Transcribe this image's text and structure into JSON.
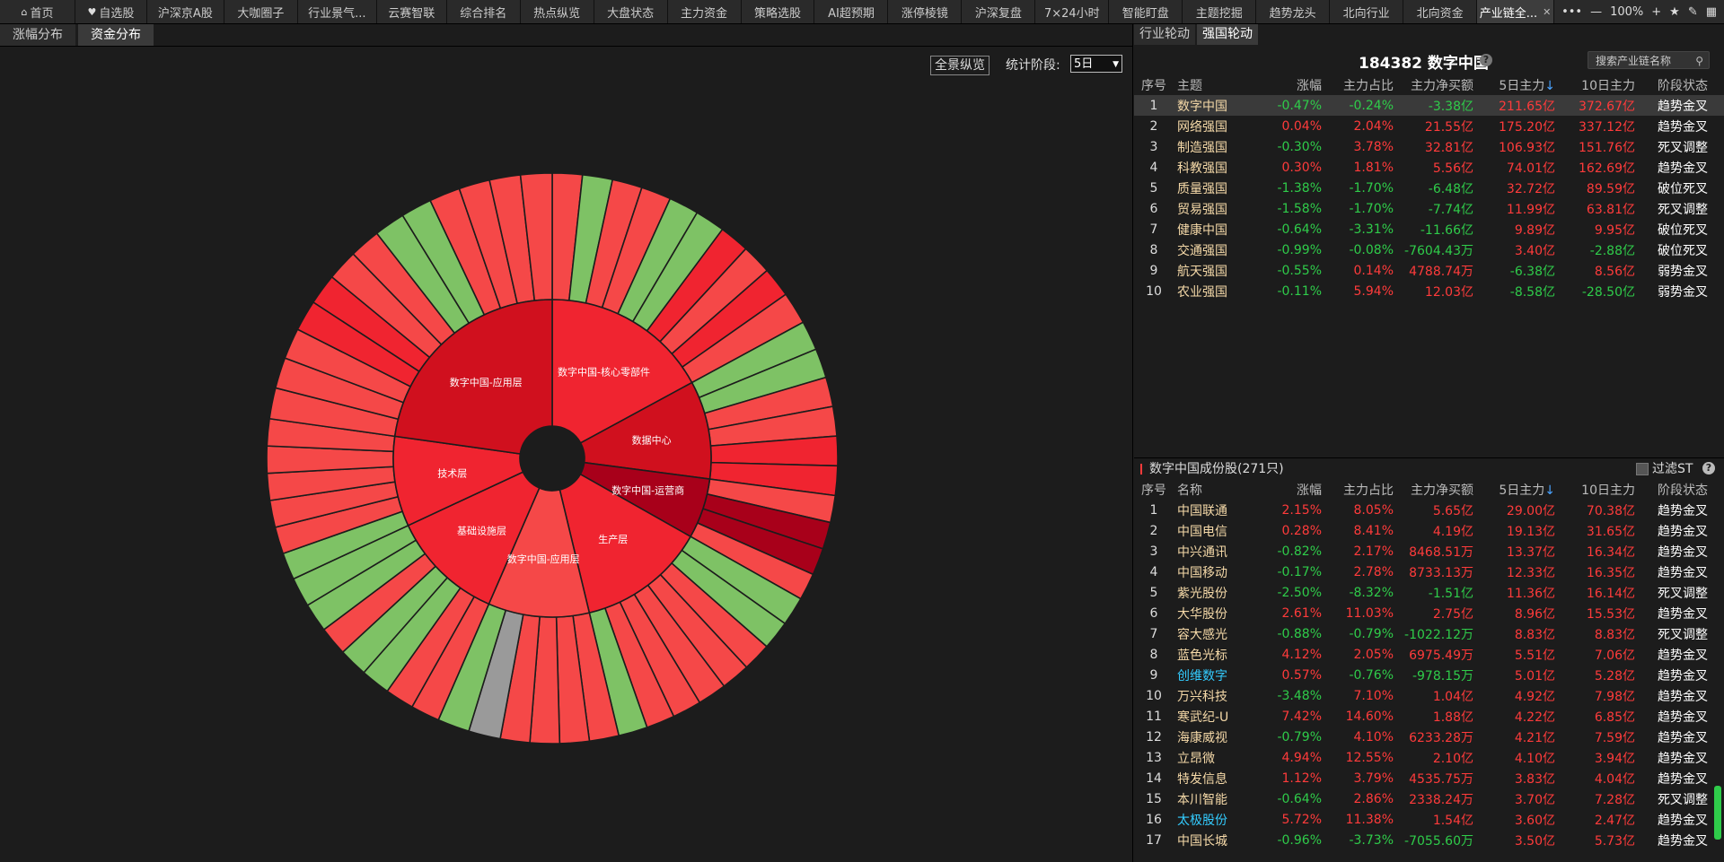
{
  "topbar": {
    "tabs": [
      {
        "label": "首页",
        "icon": "home-icon",
        "active": false
      },
      {
        "label": "自选股",
        "icon": "heart-icon",
        "active": false
      },
      {
        "label": "沪深京A股",
        "active": false
      },
      {
        "label": "大咖圈子",
        "active": false
      },
      {
        "label": "行业景气...",
        "active": false
      },
      {
        "label": "云赛智联",
        "active": false
      },
      {
        "label": "综合排名",
        "active": false
      },
      {
        "label": "热点纵览",
        "active": false
      },
      {
        "label": "大盘状态",
        "active": false
      },
      {
        "label": "主力资金",
        "active": false
      },
      {
        "label": "策略选股",
        "active": false
      },
      {
        "label": "AI超预期",
        "active": false
      },
      {
        "label": "涨停棱镜",
        "active": false
      },
      {
        "label": "沪深复盘",
        "active": false
      },
      {
        "label": "7×24小时",
        "active": false
      },
      {
        "label": "智能盯盘",
        "active": false
      },
      {
        "label": "主题挖掘",
        "active": false
      },
      {
        "label": "趋势龙头",
        "active": false
      },
      {
        "label": "北向行业",
        "active": false
      },
      {
        "label": "北向资金",
        "active": false
      },
      {
        "label": "产业链全...",
        "active": true,
        "closable": true
      }
    ],
    "zoom": "100%",
    "controls": {
      "more": "•••",
      "zoom_out": "—",
      "zoom_in": "+",
      "star": "★",
      "edit": "✎",
      "grid": "▦"
    }
  },
  "left": {
    "subtabs": [
      {
        "label": "涨幅分布",
        "active": false
      },
      {
        "label": "资金分布",
        "active": true
      }
    ],
    "overview_button": "全景纵览",
    "period_label": "统计阶段:",
    "period_value": "5日",
    "sunburst": {
      "colors": {
        "bright_red": "#f54848",
        "red": "#f02430",
        "dark_red": "#d0101e",
        "deep_red": "#a8001a",
        "green": "#7ec265",
        "gray": "#9a9a9a",
        "border": "#1c1c1c",
        "hole": "#1c1c1c"
      },
      "inner_segments": [
        {
          "label": "数字中国-核心零部件",
          "start": 0,
          "end": 61.5,
          "color": "red"
        },
        {
          "label": "数据中心",
          "start": 61.5,
          "end": 97.5,
          "color": "dark_red"
        },
        {
          "label": "数字中国-运营商",
          "start": 97.5,
          "end": 119.5,
          "color": "deep_red"
        },
        {
          "label": "生产层",
          "start": 119.5,
          "end": 166.5,
          "color": "red"
        },
        {
          "label": "数字中国-应用层",
          "start": 166.5,
          "end": 203.5,
          "color": "bright_red"
        },
        {
          "label": "基础设施层",
          "start": 203.5,
          "end": 245,
          "color": "red"
        },
        {
          "label": "技术层",
          "start": 245,
          "end": 278,
          "color": "red"
        },
        {
          "label": "数字中国-应用层",
          "start": 278,
          "end": 360,
          "color": "dark_red"
        }
      ],
      "outer_segments": [
        {
          "start": 0,
          "end": 6.1,
          "color": "bright_red"
        },
        {
          "start": 6.1,
          "end": 12.2,
          "color": "green"
        },
        {
          "start": 12.2,
          "end": 18.3,
          "color": "bright_red"
        },
        {
          "start": 18.3,
          "end": 24.4,
          "color": "bright_red"
        },
        {
          "start": 24.4,
          "end": 30.5,
          "color": "green"
        },
        {
          "start": 30.5,
          "end": 36.6,
          "color": "green"
        },
        {
          "start": 36.6,
          "end": 42.7,
          "color": "red"
        },
        {
          "start": 42.7,
          "end": 48.8,
          "color": "bright_red"
        },
        {
          "start": 48.8,
          "end": 54.9,
          "color": "red"
        },
        {
          "start": 54.9,
          "end": 61.5,
          "color": "bright_red"
        },
        {
          "start": 61.5,
          "end": 67.5,
          "color": "green"
        },
        {
          "start": 67.5,
          "end": 73.5,
          "color": "green"
        },
        {
          "start": 73.5,
          "end": 79.5,
          "color": "bright_red"
        },
        {
          "start": 79.5,
          "end": 85.5,
          "color": "bright_red"
        },
        {
          "start": 85.5,
          "end": 91.5,
          "color": "red"
        },
        {
          "start": 91.5,
          "end": 97.5,
          "color": "red"
        },
        {
          "start": 97.5,
          "end": 103,
          "color": "bright_red"
        },
        {
          "start": 103,
          "end": 108.5,
          "color": "deep_red"
        },
        {
          "start": 108.5,
          "end": 114,
          "color": "deep_red"
        },
        {
          "start": 114,
          "end": 119.5,
          "color": "bright_red"
        },
        {
          "start": 119.5,
          "end": 125.4,
          "color": "green"
        },
        {
          "start": 125.4,
          "end": 131.3,
          "color": "green"
        },
        {
          "start": 131.3,
          "end": 137.1,
          "color": "bright_red"
        },
        {
          "start": 137.1,
          "end": 143,
          "color": "bright_red"
        },
        {
          "start": 143,
          "end": 148.9,
          "color": "bright_red"
        },
        {
          "start": 148.9,
          "end": 154.8,
          "color": "bright_red"
        },
        {
          "start": 154.8,
          "end": 160.6,
          "color": "bright_red"
        },
        {
          "start": 160.6,
          "end": 166.5,
          "color": "green"
        },
        {
          "start": 166.5,
          "end": 172.5,
          "color": "bright_red"
        },
        {
          "start": 172.5,
          "end": 178.5,
          "color": "bright_red"
        },
        {
          "start": 178.5,
          "end": 184.5,
          "color": "bright_red"
        },
        {
          "start": 184.5,
          "end": 190.5,
          "color": "bright_red"
        },
        {
          "start": 190.5,
          "end": 197,
          "color": "gray"
        },
        {
          "start": 197,
          "end": 203.5,
          "color": "green"
        },
        {
          "start": 203.5,
          "end": 209.4,
          "color": "bright_red"
        },
        {
          "start": 209.4,
          "end": 215.3,
          "color": "bright_red"
        },
        {
          "start": 215.3,
          "end": 221.3,
          "color": "green"
        },
        {
          "start": 221.3,
          "end": 227.2,
          "color": "green"
        },
        {
          "start": 227.2,
          "end": 233.1,
          "color": "bright_red"
        },
        {
          "start": 233.1,
          "end": 239,
          "color": "green"
        },
        {
          "start": 239,
          "end": 245,
          "color": "green"
        },
        {
          "start": 245,
          "end": 250.5,
          "color": "green"
        },
        {
          "start": 250.5,
          "end": 256,
          "color": "bright_red"
        },
        {
          "start": 256,
          "end": 261.5,
          "color": "bright_red"
        },
        {
          "start": 261.5,
          "end": 267,
          "color": "bright_red"
        },
        {
          "start": 267,
          "end": 272.5,
          "color": "bright_red"
        },
        {
          "start": 272.5,
          "end": 278,
          "color": "bright_red"
        },
        {
          "start": 278,
          "end": 284.3,
          "color": "bright_red"
        },
        {
          "start": 284.3,
          "end": 290.6,
          "color": "bright_red"
        },
        {
          "start": 290.6,
          "end": 296.9,
          "color": "bright_red"
        },
        {
          "start": 296.9,
          "end": 303.2,
          "color": "red"
        },
        {
          "start": 303.2,
          "end": 309.5,
          "color": "red"
        },
        {
          "start": 309.5,
          "end": 315.8,
          "color": "bright_red"
        },
        {
          "start": 315.8,
          "end": 322.1,
          "color": "bright_red"
        },
        {
          "start": 322.1,
          "end": 328.4,
          "color": "green"
        },
        {
          "start": 328.4,
          "end": 334.7,
          "color": "green"
        },
        {
          "start": 334.7,
          "end": 341,
          "color": "bright_red"
        },
        {
          "start": 341,
          "end": 347.3,
          "color": "bright_red"
        },
        {
          "start": 347.3,
          "end": 353.6,
          "color": "bright_red"
        },
        {
          "start": 353.6,
          "end": 360,
          "color": "bright_red"
        }
      ]
    }
  },
  "right": {
    "tabs": [
      {
        "label": "行业轮动",
        "active": false
      },
      {
        "label": "强国轮动",
        "active": true
      }
    ],
    "index_title": "184382 数字中国",
    "search_placeholder": "搜索产业链名称",
    "top_table": {
      "headers": [
        "序号",
        "主题",
        "涨幅",
        "主力占比",
        "主力净买额",
        "5日主力",
        "10日主力",
        "阶段状态"
      ],
      "sort_arrow": "↓",
      "rows": [
        {
          "no": "1",
          "name": "数字中国",
          "chg": "-0.47%",
          "ratio": "-0.24%",
          "net": "-3.38亿",
          "d5": "211.65亿",
          "d10": "372.67亿",
          "stage": "趋势金叉",
          "selected": true
        },
        {
          "no": "2",
          "name": "网络强国",
          "chg": "0.04%",
          "ratio": "2.04%",
          "net": "21.55亿",
          "d5": "175.20亿",
          "d10": "337.12亿",
          "stage": "趋势金叉"
        },
        {
          "no": "3",
          "name": "制造强国",
          "chg": "-0.30%",
          "ratio": "3.78%",
          "net": "32.81亿",
          "d5": "106.93亿",
          "d10": "151.76亿",
          "stage": "死叉调整"
        },
        {
          "no": "4",
          "name": "科教强国",
          "chg": "0.30%",
          "ratio": "1.81%",
          "net": "5.56亿",
          "d5": "74.01亿",
          "d10": "162.69亿",
          "stage": "趋势金叉"
        },
        {
          "no": "5",
          "name": "质量强国",
          "chg": "-1.38%",
          "ratio": "-1.70%",
          "net": "-6.48亿",
          "d5": "32.72亿",
          "d10": "89.59亿",
          "stage": "破位死叉"
        },
        {
          "no": "6",
          "name": "贸易强国",
          "chg": "-1.58%",
          "ratio": "-1.70%",
          "net": "-7.74亿",
          "d5": "11.99亿",
          "d10": "63.81亿",
          "stage": "死叉调整"
        },
        {
          "no": "7",
          "name": "健康中国",
          "chg": "-0.64%",
          "ratio": "-3.31%",
          "net": "-11.66亿",
          "d5": "9.89亿",
          "d10": "9.95亿",
          "stage": "破位死叉"
        },
        {
          "no": "8",
          "name": "交通强国",
          "chg": "-0.99%",
          "ratio": "-0.08%",
          "net": "-7604.43万",
          "d5": "3.40亿",
          "d10": "-2.88亿",
          "stage": "破位死叉"
        },
        {
          "no": "9",
          "name": "航天强国",
          "chg": "-0.55%",
          "ratio": "0.14%",
          "net": "4788.74万",
          "d5": "-6.38亿",
          "d10": "8.56亿",
          "stage": "弱势金叉"
        },
        {
          "no": "10",
          "name": "农业强国",
          "chg": "-0.11%",
          "ratio": "5.94%",
          "net": "12.03亿",
          "d5": "-8.58亿",
          "d10": "-28.50亿",
          "stage": "弱势金叉"
        }
      ]
    },
    "constituents": {
      "title": "数字中国成份股(271只)",
      "filter_label": "过滤ST",
      "headers": [
        "序号",
        "名称",
        "涨幅",
        "主力占比",
        "主力净买额",
        "5日主力",
        "10日主力",
        "阶段状态"
      ],
      "sort_arrow": "↓",
      "rows": [
        {
          "no": "1",
          "name": "中国联通",
          "chg": "2.15%",
          "ratio": "8.05%",
          "net": "5.65亿",
          "d5": "29.00亿",
          "d10": "70.38亿",
          "stage": "趋势金叉"
        },
        {
          "no": "2",
          "name": "中国电信",
          "chg": "0.28%",
          "ratio": "8.41%",
          "net": "4.19亿",
          "d5": "19.13亿",
          "d10": "31.65亿",
          "stage": "趋势金叉"
        },
        {
          "no": "3",
          "name": "中兴通讯",
          "chg": "-0.82%",
          "ratio": "2.17%",
          "net": "8468.51万",
          "d5": "13.37亿",
          "d10": "16.34亿",
          "stage": "趋势金叉"
        },
        {
          "no": "4",
          "name": "中国移动",
          "chg": "-0.17%",
          "ratio": "2.78%",
          "net": "8733.13万",
          "d5": "12.33亿",
          "d10": "16.35亿",
          "stage": "趋势金叉"
        },
        {
          "no": "5",
          "name": "紫光股份",
          "chg": "-2.50%",
          "ratio": "-8.32%",
          "net": "-1.51亿",
          "d5": "11.36亿",
          "d10": "16.14亿",
          "stage": "死叉调整"
        },
        {
          "no": "6",
          "name": "大华股份",
          "chg": "2.61%",
          "ratio": "11.03%",
          "net": "2.75亿",
          "d5": "8.96亿",
          "d10": "15.53亿",
          "stage": "趋势金叉"
        },
        {
          "no": "7",
          "name": "容大感光",
          "chg": "-0.88%",
          "ratio": "-0.79%",
          "net": "-1022.12万",
          "d5": "8.83亿",
          "d10": "8.83亿",
          "stage": "死叉调整"
        },
        {
          "no": "8",
          "name": "蓝色光标",
          "chg": "4.12%",
          "ratio": "2.05%",
          "net": "6975.49万",
          "d5": "5.51亿",
          "d10": "7.06亿",
          "stage": "趋势金叉"
        },
        {
          "no": "9",
          "name": "创维数字",
          "chg": "0.57%",
          "ratio": "-0.76%",
          "net": "-978.15万",
          "d5": "5.01亿",
          "d10": "5.28亿",
          "stage": "趋势金叉",
          "highlight": true
        },
        {
          "no": "10",
          "name": "万兴科技",
          "chg": "-3.48%",
          "ratio": "7.10%",
          "net": "1.04亿",
          "d5": "4.92亿",
          "d10": "7.98亿",
          "stage": "趋势金叉"
        },
        {
          "no": "11",
          "name": "寒武纪-U",
          "chg": "7.42%",
          "ratio": "14.60%",
          "net": "1.88亿",
          "d5": "4.22亿",
          "d10": "6.85亿",
          "stage": "趋势金叉"
        },
        {
          "no": "12",
          "name": "海康威视",
          "chg": "-0.79%",
          "ratio": "4.10%",
          "net": "6233.28万",
          "d5": "4.21亿",
          "d10": "7.59亿",
          "stage": "趋势金叉"
        },
        {
          "no": "13",
          "name": "立昂微",
          "chg": "4.94%",
          "ratio": "12.55%",
          "net": "2.10亿",
          "d5": "4.10亿",
          "d10": "3.94亿",
          "stage": "趋势金叉"
        },
        {
          "no": "14",
          "name": "特发信息",
          "chg": "1.12%",
          "ratio": "3.79%",
          "net": "4535.75万",
          "d5": "3.83亿",
          "d10": "4.04亿",
          "stage": "趋势金叉"
        },
        {
          "no": "15",
          "name": "本川智能",
          "chg": "-0.64%",
          "ratio": "2.86%",
          "net": "2338.24万",
          "d5": "3.70亿",
          "d10": "7.28亿",
          "stage": "死叉调整"
        },
        {
          "no": "16",
          "name": "太极股份",
          "chg": "5.72%",
          "ratio": "11.38%",
          "net": "1.54亿",
          "d5": "3.60亿",
          "d10": "2.47亿",
          "stage": "趋势金叉",
          "highlight": true
        },
        {
          "no": "17",
          "name": "中国长城",
          "chg": "-0.96%",
          "ratio": "-3.73%",
          "net": "-7055.60万",
          "d5": "3.50亿",
          "d10": "5.73亿",
          "stage": "趋势金叉"
        }
      ]
    }
  }
}
